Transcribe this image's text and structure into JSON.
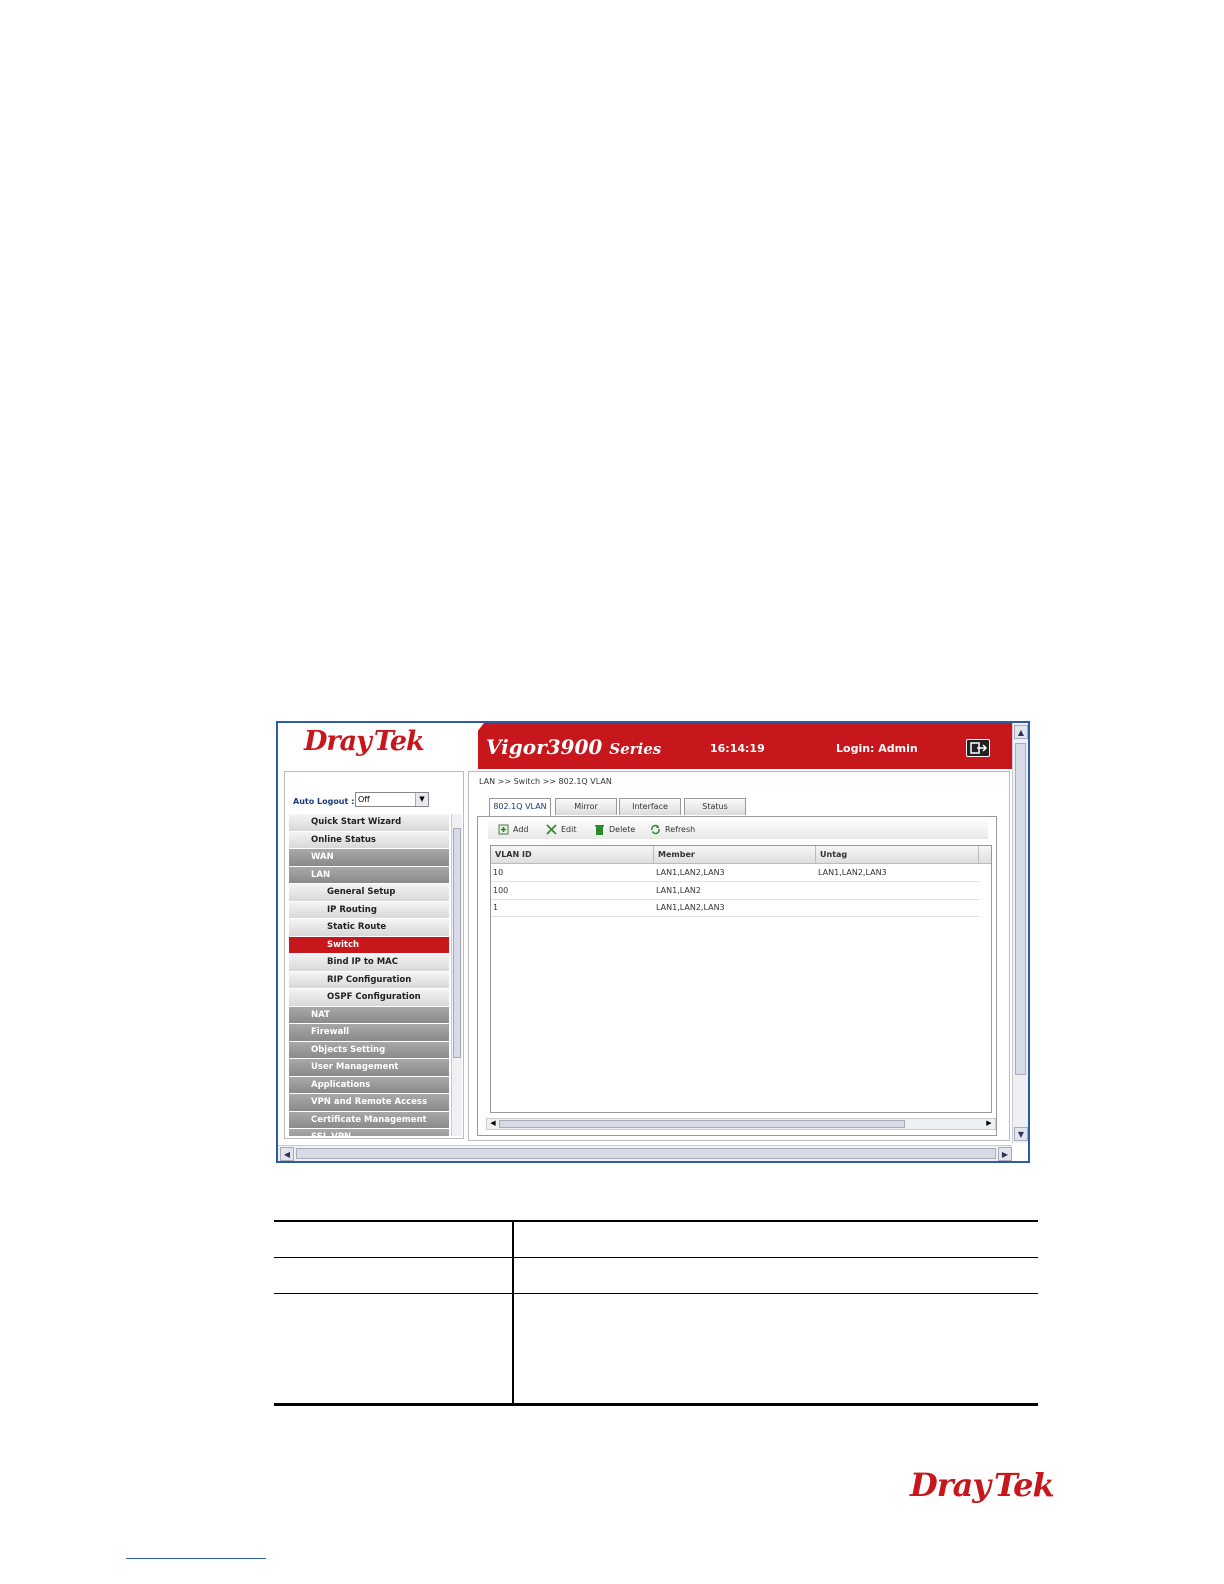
{
  "header": {
    "brand_dray": "Dray",
    "brand_tek": "Tek",
    "model": "Vigor3900",
    "series": "Series",
    "time": "16:14:19",
    "login": "Login: Admin"
  },
  "sidebar": {
    "auto_logout_label": "Auto Logout :",
    "auto_logout_value": "Off",
    "items": [
      {
        "label": "Quick Start Wizard",
        "style": "light"
      },
      {
        "label": "Online Status",
        "style": "light"
      },
      {
        "label": "WAN",
        "style": "dark"
      },
      {
        "label": "LAN",
        "style": "dark"
      },
      {
        "label": "General Setup",
        "style": "sub"
      },
      {
        "label": "IP Routing",
        "style": "sub"
      },
      {
        "label": "Static Route",
        "style": "sub"
      },
      {
        "label": "Switch",
        "style": "active"
      },
      {
        "label": "Bind IP to MAC",
        "style": "sub"
      },
      {
        "label": "RIP Configuration",
        "style": "sub"
      },
      {
        "label": "OSPF Configuration",
        "style": "sub"
      },
      {
        "label": "NAT",
        "style": "dark"
      },
      {
        "label": "Firewall",
        "style": "dark"
      },
      {
        "label": "Objects Setting",
        "style": "dark"
      },
      {
        "label": "User Management",
        "style": "dark"
      },
      {
        "label": "Applications",
        "style": "dark"
      },
      {
        "label": "VPN and Remote Access",
        "style": "dark"
      },
      {
        "label": "Certificate Management",
        "style": "dark"
      },
      {
        "label": "SSL VPN",
        "style": "dark"
      }
    ]
  },
  "main": {
    "breadcrumb": "LAN >> Switch >> 802.1Q VLAN",
    "tabs": [
      "802.1Q VLAN",
      "Mirror",
      "Interface",
      "Status"
    ],
    "toolbar": {
      "add": "Add",
      "edit": "Edit",
      "delete": "Delete",
      "refresh": "Refresh"
    },
    "columns": [
      "VLAN ID",
      "Member",
      "Untag"
    ],
    "rows": [
      [
        "10",
        "LAN1,LAN2,LAN3",
        "LAN1,LAN2,LAN3"
      ],
      [
        "100",
        "LAN1,LAN2",
        ""
      ],
      [
        "1",
        "LAN1,LAN2,LAN3",
        ""
      ]
    ]
  },
  "footer": {
    "brand_dray": "Dray",
    "brand_tek": "Tek"
  },
  "colors": {
    "brand_red": "#c8161d",
    "frame_blue": "#2f5aa8"
  }
}
